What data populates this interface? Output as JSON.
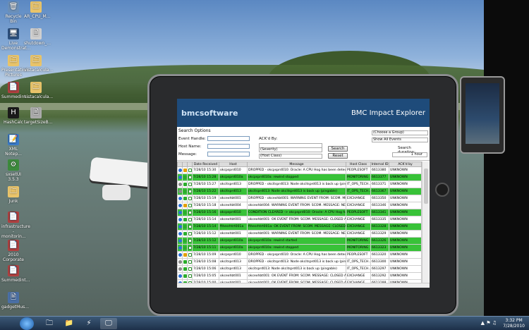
{
  "desktop": {
    "icons": [
      {
        "label": "Recycle Bin",
        "glyph": "🗑"
      },
      {
        "label": "AR_CPU_M...",
        "glyph": "🗀"
      },
      {
        "label": "Live Demonstrat...",
        "glyph": "🖥"
      },
      {
        "label": "shutdown_...",
        "glyph": "🗎"
      },
      {
        "label": "Presentation Pictures",
        "glyph": "🗀"
      },
      {
        "label": "vistacalcula...",
        "glyph": "🗀"
      },
      {
        "label": "Summedint...",
        "glyph": "📄"
      },
      {
        "label": "vistacalcula...",
        "glyph": "🗀"
      },
      {
        "label": "HashCalc",
        "glyph": "H"
      },
      {
        "label": "targetSizeB...",
        "glyph": "🗎"
      },
      {
        "label": "XML Notep...",
        "glyph": "📝"
      },
      {
        "label": "sxsetUI 3.5.3",
        "glyph": "⚙"
      },
      {
        "label": "Junk",
        "glyph": "🗀"
      },
      {
        "label": "infrastructure - monitorin...",
        "glyph": "📄"
      },
      {
        "label": "2010 Corporate ...",
        "glyph": "📄"
      },
      {
        "label": "Summedint...",
        "glyph": "📄"
      },
      {
        "label": "gadgetMus...",
        "glyph": "🖹"
      }
    ]
  },
  "app": {
    "logo": "bmcsoftware",
    "title": "BMC Impact Explorer",
    "search": {
      "section_title": "Search Options",
      "event_handle_label": "Event Handle:",
      "host_name_label": "Host Name:",
      "message_label": "Message:",
      "ackd_by_label": "ACK'd By:",
      "severity_option": "(Severity)",
      "host_class_option": "(Host Class)",
      "group_option": "(Choose a Group)",
      "events_option": "Show All Events",
      "duration_label": "Search duration:",
      "duration_option": "1 hour",
      "search_button": "Search",
      "reset_button": "Reset"
    },
    "table": {
      "headers": [
        "",
        "",
        "",
        "Date Received",
        "Host",
        "Message",
        "Host Class",
        "Internal ID",
        "ACK'd by"
      ],
      "rows": [
        {
          "hl": false,
          "date": "7/28/10 15:30",
          "host": "okcpsprd010",
          "msg": "DROPPED - okcpsprd010: Oracle: A CPU Hog has been detected",
          "cls": "PEOPLESOFT",
          "id": "6613380",
          "ack": "UNKNOWN",
          "sev": "#2b6fd6",
          "st": "#e5a100"
        },
        {
          "hl": true,
          "date": "7/28/10 15:28",
          "host": "okcpsprd010a",
          "msg": "okcpsprd010a: rewind stopped",
          "cls": "MONITORING",
          "id": "6613377",
          "ack": "UNKNOWN",
          "sev": "#2b6fd6",
          "st": "#2cae2c"
        },
        {
          "hl": false,
          "date": "7/28/10 15:27",
          "host": "okcitsprd013",
          "msg": "DROPPED - okcitsprd013: Node okcitsprd013 is back up (pingable)",
          "cls": "IT_OPS_TECH...",
          "id": "6613371",
          "ack": "UNKNOWN",
          "sev": "#8a8a8a",
          "st": "#2cae2c"
        },
        {
          "hl": true,
          "date": "7/28/10 15:22",
          "host": "okcitsprd013",
          "msg": "okcitsprd013: Node okcitsprd013 is back up (pingable)",
          "cls": "IT_OPS_TECH...",
          "id": "6613367",
          "ack": "UNKNOWN",
          "sev": "#8a8a8a",
          "st": "#2cae2c"
        },
        {
          "hl": false,
          "date": "7/28/10 15:19",
          "host": "okcexhbt001",
          "msg": "DROPPED - okcexhbt001: WARNING EVENT FROM: SCOM. MESSAGE: CLOSED ALE",
          "cls": "EXCHANGE",
          "id": "6613350",
          "ack": "UNKNOWN",
          "sev": "#2b6fd6",
          "st": "#2cae2c"
        },
        {
          "hl": false,
          "date": "7/28/10 15:18",
          "host": "okcexhbt004",
          "msg": "okcexhbt004: WARNING EVENT FROM: SCOM. MESSAGE: NEW",
          "cls": "EXCHANGE",
          "id": "6613346",
          "ack": "UNKNOWN",
          "sev": "#2b6fd6",
          "st": "#e5a100"
        },
        {
          "hl": true,
          "date": "7/28/10 15:16",
          "host": "okcpsprd010",
          "msg": "CONDITION CLEARED -> okcpsprd010: Oracle: A CPU Hog has been",
          "cls": "PEOPLESOFT",
          "id": "6613341",
          "ack": "UNKNOWN",
          "sev": "#2b6fd6",
          "st": "#2cae2c"
        },
        {
          "hl": false,
          "date": "7/28/10 15:14",
          "host": "okcexhbt001",
          "msg": "okcexhbt001: OK EVENT FROM: SCOM. MESSAGE: CLOSED ALE",
          "cls": "EXCHANGE",
          "id": "6613335",
          "ack": "UNKNOWN",
          "sev": "#2b6fd6",
          "st": "#2cae2c"
        },
        {
          "hl": true,
          "date": "7/28/10 15:14",
          "host": "fthesrhtrt001a",
          "msg": "fthesrhtrt001a: OK EVENT FROM: SCOM. MESSAGE: CLOSED ALE",
          "cls": "EXCHANGE",
          "id": "6613328",
          "ack": "UNKNOWN",
          "sev": "#2b6fd6",
          "st": "#2cae2c"
        },
        {
          "hl": false,
          "date": "7/28/10 15:12",
          "host": "okcexhbt001",
          "msg": "okcexhbt001: WARNING EVENT FROM: SCOM. MESSAGE: NEW ALE",
          "cls": "EXCHANGE",
          "id": "6613329",
          "ack": "UNKNOWN",
          "sev": "#2b6fd6",
          "st": "#2cae2c"
        },
        {
          "hl": true,
          "date": "7/28/10 15:12",
          "host": "okcpsprd010a",
          "msg": "okcpsprd010a: rewind started",
          "cls": "MONITORING",
          "id": "6613326",
          "ack": "UNKNOWN",
          "sev": "#2b6fd6",
          "st": "#2cae2c"
        },
        {
          "hl": true,
          "date": "7/28/10 15:11",
          "host": "okcpsprd010a",
          "msg": "okcpsprd010a: rewind stopped",
          "cls": "MONITORING",
          "id": "6613323",
          "ack": "UNKNOWN",
          "sev": "#2b6fd6",
          "st": "#2cae2c"
        },
        {
          "hl": false,
          "date": "7/28/10 15:09",
          "host": "okcpsprd010",
          "msg": "DROPPED - okcpsprd010: Oracle: A CPU Hog has been detected",
          "cls": "PEOPLESOFT",
          "id": "6613320",
          "ack": "UNKNOWN",
          "sev": "#2b6fd6",
          "st": "#e5a100"
        },
        {
          "hl": false,
          "date": "7/28/10 15:08",
          "host": "okcitsprd013",
          "msg": "DROPPED - okcitsprd013: Node okcitsprd013 is back up (pingable)",
          "cls": "IT_OPS_TECH...",
          "id": "6613300",
          "ack": "UNKNOWN",
          "sev": "#8a8a8a",
          "st": "#2cae2c"
        },
        {
          "hl": false,
          "date": "7/28/10 15:06",
          "host": "okcitsprd013",
          "msg": "okcitsprd013: Node okcitsprd013 is back up (pingable)",
          "cls": "IT_OPS_TECH...",
          "id": "6613297",
          "ack": "UNKNOWN",
          "sev": "#8a8a8a",
          "st": "#2cae2c"
        },
        {
          "hl": false,
          "date": "7/28/10 15:05",
          "host": "okcexhbt001",
          "msg": "okcexhbt001: OK EVENT FROM: SCOM. MESSAGE: CLOSED ALE",
          "cls": "EXCHANGE",
          "id": "6613292",
          "ack": "UNKNOWN",
          "sev": "#2b6fd6",
          "st": "#2cae2c"
        },
        {
          "hl": false,
          "date": "7/28/10 15:00",
          "host": "okcexhbt001",
          "msg": "okcexhbt001: OK EVENT FROM: SCOM. MESSAGE: CLOSED ALE",
          "cls": "EXCHANGE",
          "id": "6613288",
          "ack": "UNKNOWN",
          "sev": "#2b6fd6",
          "st": "#2cae2c"
        }
      ]
    }
  },
  "taskbar": {
    "time": "3:32 PM",
    "date": "7/28/2010",
    "apps": [
      "🗀",
      "📁",
      "⚡",
      "🖵"
    ]
  },
  "colors": {
    "header": "#1e4b7a",
    "row_highlight": "#38c238"
  }
}
